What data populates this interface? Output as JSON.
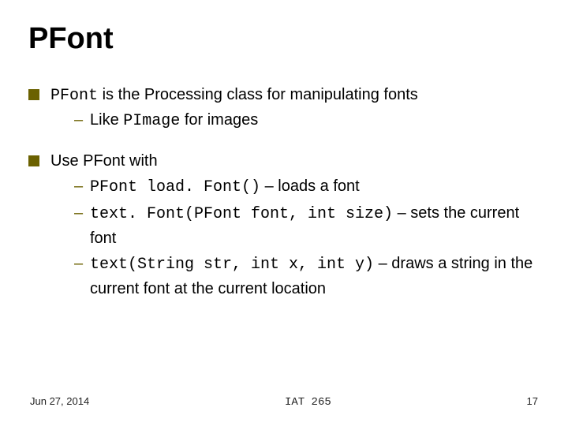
{
  "title": "PFont",
  "bullets": [
    {
      "main_pre_code": "",
      "main_code": "PFont",
      "main_post": " is the Processing class for manipulating fonts",
      "subs": [
        {
          "dash": "–",
          "pre": "Like ",
          "code": "PImage",
          "post": " for images"
        }
      ]
    },
    {
      "main_pre_code": "Use PFont with",
      "main_code": "",
      "main_post": "",
      "subs": [
        {
          "dash": "–",
          "pre": "",
          "code": "PFont load. Font()",
          "post": " – loads a font"
        },
        {
          "dash": "–",
          "pre": "",
          "code": "text. Font(PFont font, int size)",
          "post": " – sets the current font"
        },
        {
          "dash": "–",
          "pre": "",
          "code": "text(String str, int x, int y)",
          "post": " – draws a string in the current font at the current location"
        }
      ]
    }
  ],
  "footer": {
    "left": "Jun 27, 2014",
    "center": "IAT 265",
    "right": "17"
  }
}
